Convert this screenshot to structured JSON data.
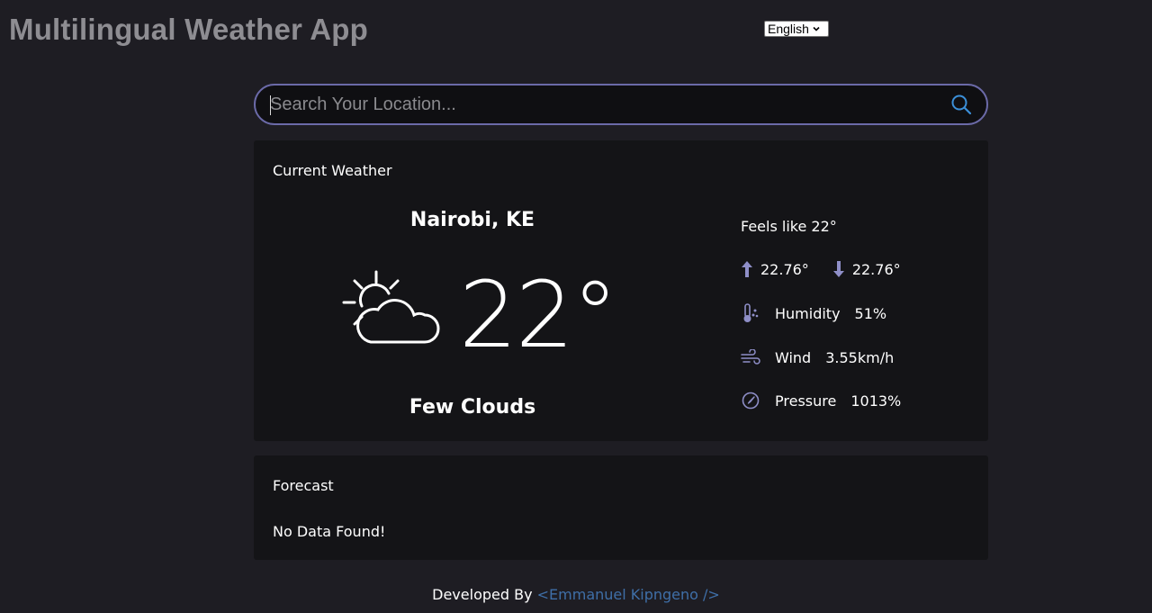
{
  "app": {
    "title": "Multilingual Weather App"
  },
  "language": {
    "selected": "English"
  },
  "search": {
    "placeholder": "Search Your Location..."
  },
  "current": {
    "heading": "Current Weather",
    "location": "Nairobi, KE",
    "temperature": "22°",
    "description": "Few Clouds",
    "icon": "partly-cloudy-icon",
    "feels_like": "Feels like 22°",
    "max_temp": "22.76°",
    "min_temp": "22.76°",
    "humidity_label": "Humidity",
    "humidity_value": "51%",
    "wind_label": "Wind",
    "wind_value": "3.55km/h",
    "pressure_label": "Pressure",
    "pressure_value": "1013%"
  },
  "forecast": {
    "heading": "Forecast",
    "empty_message": "No Data Found!"
  },
  "footer": {
    "prefix": "Developed By",
    "author_link": "<Emmanuel Kipngeno />"
  },
  "colors": {
    "background": "#1e1d23",
    "card": "#141417",
    "accent": "#6b6aa8",
    "link": "#3f6fa8",
    "search_icon": "#3b8fd8"
  }
}
